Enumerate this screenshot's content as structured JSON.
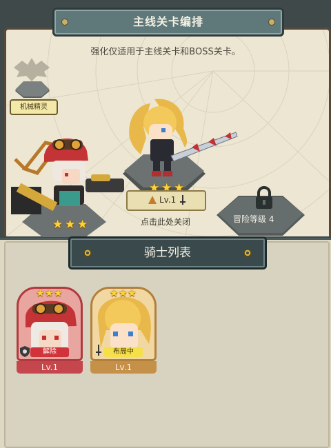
{
  "header": {
    "title": "主线关卡编排"
  },
  "notice": "强化仅适用于主线关卡和BOSS关卡。",
  "formation": {
    "spirit_slot_label": "机械精灵",
    "placed_knight": {
      "level": "Lv.1",
      "stars": 3,
      "weapon_icon": "sword-icon"
    },
    "front_knight": {
      "stars": 3
    },
    "close_hint": "点击此处关闭",
    "locked_slot": {
      "label": "冒险等级 4",
      "icon": "lock-icon"
    }
  },
  "knight_list": {
    "title": "骑士列表",
    "cards": [
      {
        "stars": 3,
        "tag": "解除",
        "level": "Lv.1",
        "theme": "red",
        "badge_icon": "shield-icon"
      },
      {
        "stars": 3,
        "tag": "布局中",
        "level": "Lv.1",
        "theme": "gold",
        "badge_icon": "sword-icon"
      }
    ]
  },
  "colors": {
    "frame": "#59493a",
    "plate": "#3a4a4c",
    "star": "#ffd23b",
    "card_red": "#c5474d",
    "card_gold": "#c59048",
    "tag_red": "#d0343a",
    "tag_yellow": "#f6e04a"
  }
}
